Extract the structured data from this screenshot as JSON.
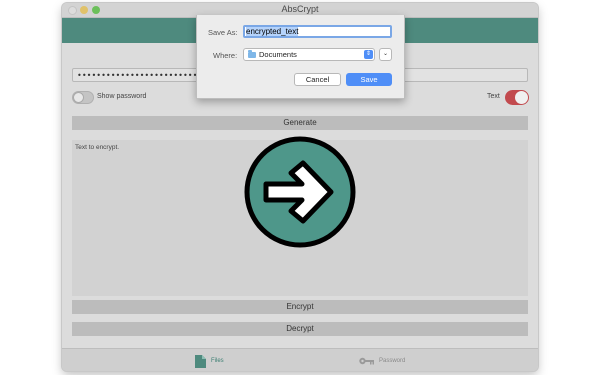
{
  "window": {
    "title": "AbsCrypt"
  },
  "password": {
    "value": "••••••••••••••••••••••••••••••"
  },
  "options": {
    "show_password_label": "Show password",
    "show_password_on": false,
    "text_mode_label": "Text",
    "text_mode_on": true
  },
  "buttons": {
    "generate": "Generate",
    "encrypt": "Encrypt",
    "decrypt": "Decrypt"
  },
  "editor": {
    "placeholder": "Text to encrypt."
  },
  "tabs": [
    {
      "label": "Files",
      "icon": "file-icon",
      "active": true
    },
    {
      "label": "Password",
      "icon": "key-icon",
      "active": false
    }
  ],
  "save_dialog": {
    "save_as_label": "Save As:",
    "filename": "encrypted_text",
    "where_label": "Where:",
    "location": "Documents",
    "cancel": "Cancel",
    "save": "Save"
  },
  "colors": {
    "accent": "#4e8a7e",
    "toggle_on": "#c24a4e",
    "dialog_primary": "#4f8ef7"
  }
}
